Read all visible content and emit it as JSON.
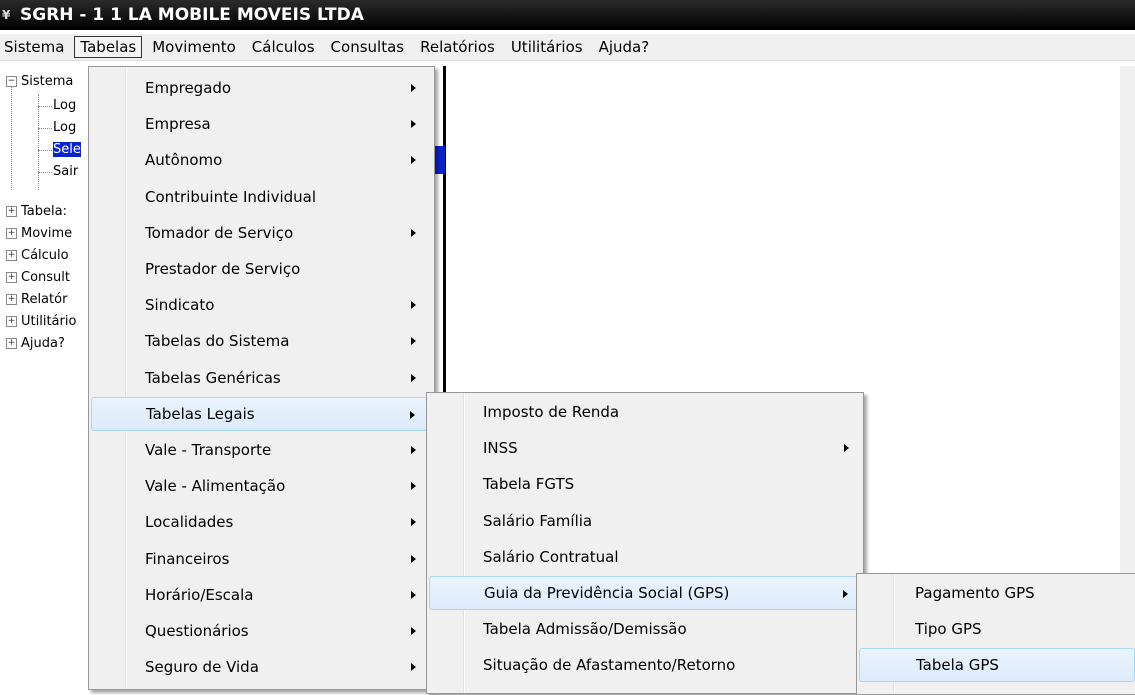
{
  "window": {
    "title": "SGRH - 1 1 LA MOBILE MOVEIS LTDA",
    "icon": "app-icon"
  },
  "menubar": [
    {
      "label": "Sistema"
    },
    {
      "label": "Tabelas",
      "active": true
    },
    {
      "label": "Movimento"
    },
    {
      "label": "Cálculos"
    },
    {
      "label": "Consultas"
    },
    {
      "label": "Relatórios"
    },
    {
      "label": "Utilitários"
    },
    {
      "label": "Ajuda?"
    }
  ],
  "tree": {
    "root": {
      "label": "Sistema",
      "children": [
        "Log",
        "Log",
        "Sele",
        "Sair"
      ],
      "selected_child": "Sele"
    },
    "nodes": [
      "Tabela:",
      "Movime",
      "Cálculo",
      "Consult",
      "Relatór",
      "Utilitário",
      "Ajuda?"
    ]
  },
  "menus": {
    "tabelas": [
      {
        "label": "Empregado",
        "submenu": true
      },
      {
        "label": "Empresa",
        "submenu": true
      },
      {
        "label": "Autônomo",
        "submenu": true
      },
      {
        "label": "Contribuinte Individual",
        "submenu": false
      },
      {
        "label": "Tomador de Serviço",
        "submenu": true
      },
      {
        "label": "Prestador de Serviço",
        "submenu": false
      },
      {
        "label": "Sindicato",
        "submenu": true
      },
      {
        "label": "Tabelas do Sistema",
        "submenu": true
      },
      {
        "label": "Tabelas Genéricas",
        "submenu": true
      },
      {
        "label": "Tabelas Legais",
        "submenu": true,
        "highlighted": true
      },
      {
        "label": "Vale - Transporte",
        "submenu": true
      },
      {
        "label": "Vale - Alimentação",
        "submenu": true
      },
      {
        "label": "Localidades",
        "submenu": true
      },
      {
        "label": "Financeiros",
        "submenu": true
      },
      {
        "label": "Horário/Escala",
        "submenu": true
      },
      {
        "label": "Questionários",
        "submenu": true
      },
      {
        "label": "Seguro de Vida",
        "submenu": true
      }
    ],
    "tabelas_legais": [
      {
        "label": "Imposto de Renda",
        "submenu": false
      },
      {
        "label": "INSS",
        "submenu": true
      },
      {
        "label": "Tabela FGTS",
        "submenu": false
      },
      {
        "label": "Salário Família",
        "submenu": false
      },
      {
        "label": "Salário Contratual",
        "submenu": false
      },
      {
        "label": "Guia da Previdência Social (GPS)",
        "submenu": true,
        "highlighted": true
      },
      {
        "label": "Tabela Admissão/Demissão",
        "submenu": false
      },
      {
        "label": "Situação de Afastamento/Retorno",
        "submenu": false
      }
    ],
    "gps": [
      {
        "label": "Pagamento GPS",
        "submenu": false
      },
      {
        "label": "Tipo GPS",
        "submenu": false
      },
      {
        "label": "Tabela GPS",
        "submenu": false,
        "highlighted": true
      }
    ]
  },
  "colors": {
    "highlight_border": "#a8d8f2",
    "tree_selection": "#0a24c8",
    "menu_bg": "#f0f0f0"
  }
}
